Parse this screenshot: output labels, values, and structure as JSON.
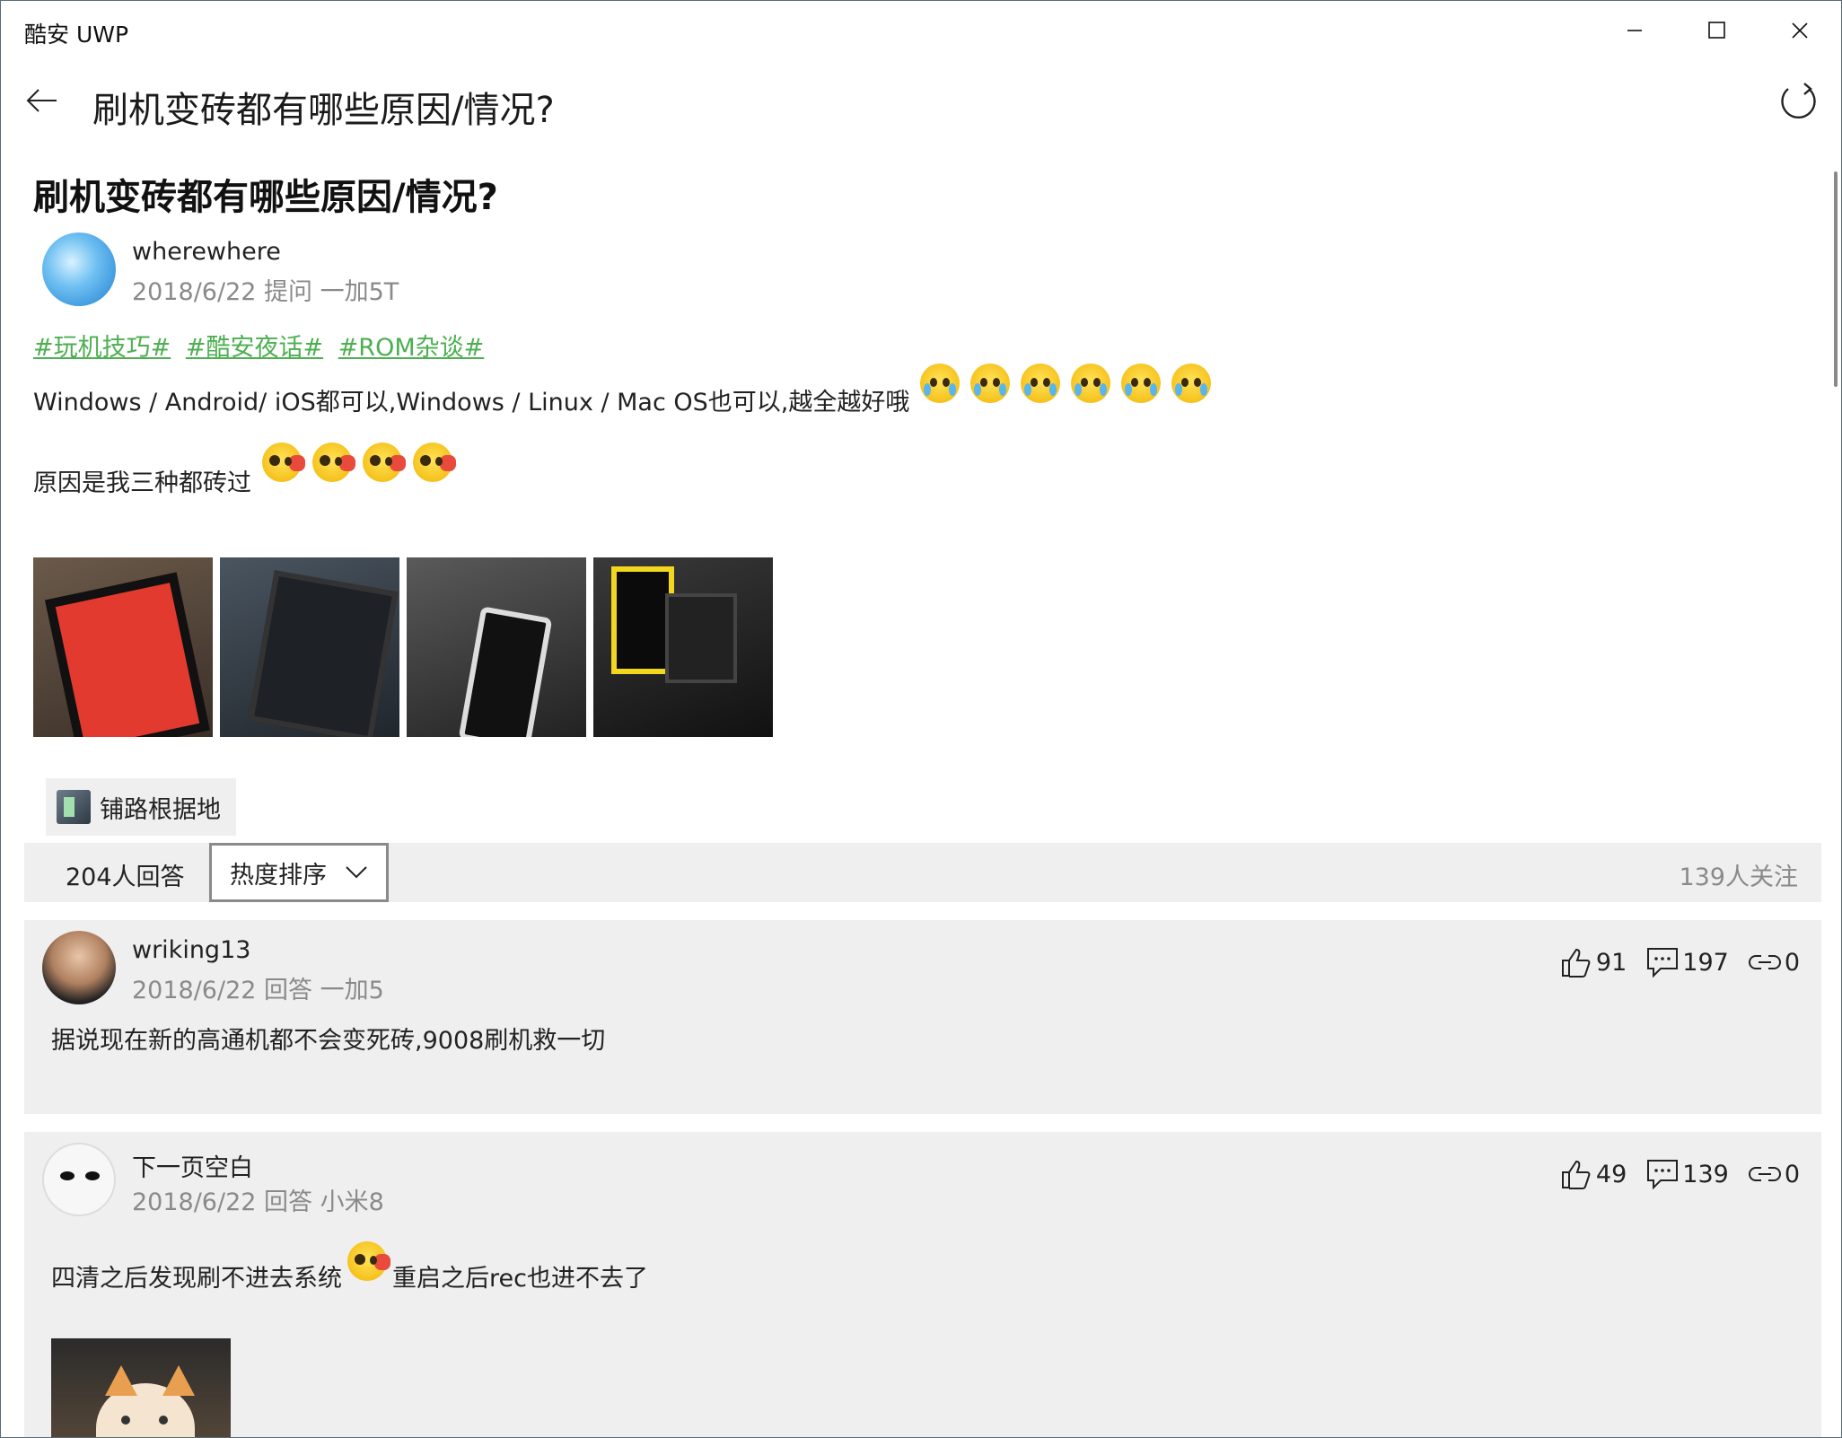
{
  "window": {
    "app_title": "酷安 UWP"
  },
  "header": {
    "title": "刷机变砖都有哪些原因/情况?"
  },
  "question": {
    "title": "刷机变砖都有哪些原因/情况?",
    "author": "wherewhere",
    "meta": "2018/6/22 提问 一加5T",
    "tags": [
      "#玩机技巧#",
      "#酷安夜话#",
      "#ROM杂谈#"
    ],
    "paragraph1": "Windows / Android/ iOS都可以,Windows / Linux / Mac OS也可以,越全越好哦",
    "paragraph1_emoji": [
      "crying-laugh-emoji",
      "crying-laugh-emoji",
      "crying-laugh-emoji",
      "crying-laugh-emoji",
      "crying-laugh-emoji",
      "crying-laugh-emoji"
    ],
    "paragraph2": "原因是我三种都砖过",
    "paragraph2_emoji": [
      "shy-emoji",
      "shy-emoji",
      "shy-emoji",
      "shy-emoji"
    ],
    "images": [
      "phone-red-screen-photo",
      "tablet-photo",
      "galaxy-s4-photo",
      "lumia-yellow-photo"
    ],
    "topic": "铺路根据地"
  },
  "sort_bar": {
    "answer_count": "204人回答",
    "sort_option": "热度排序",
    "follow_count": "139人关注"
  },
  "answers": [
    {
      "author": "wriking13",
      "meta": "2018/6/22 回答 一加5",
      "likes": "91",
      "comments": "197",
      "shares": "0",
      "text": "据说现在新的高通机都不会变死砖,9008刷机救一切"
    },
    {
      "author": "下一页空白",
      "meta": "2018/6/22 回答 小米8",
      "likes": "49",
      "comments": "139",
      "shares": "0",
      "text_before": "四清之后发现刷不进去系统",
      "text_after": "重启之后rec也进不去了",
      "emoji": "shy-emoji",
      "image": "cat-photo"
    }
  ]
}
